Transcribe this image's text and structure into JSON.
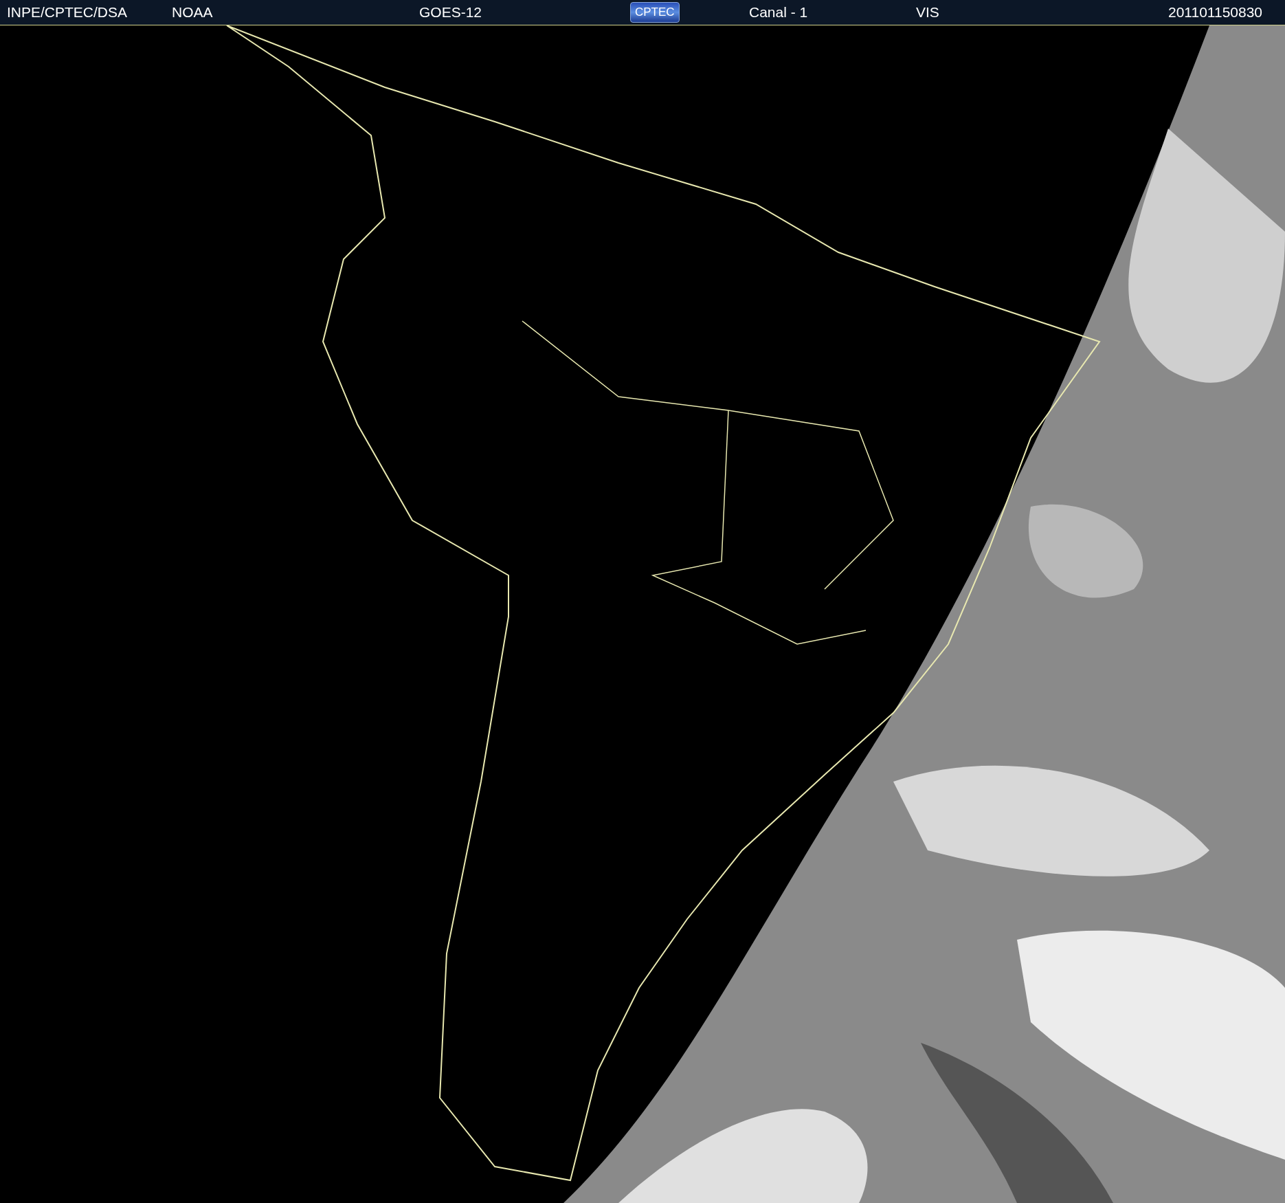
{
  "header": {
    "items": [
      {
        "kind": "text",
        "text": "INPE/CPTEC/DSA"
      },
      {
        "kind": "text",
        "text": "NOAA"
      },
      {
        "kind": "text",
        "text": "GOES-12"
      },
      {
        "kind": "logo",
        "text": "CPTEC"
      },
      {
        "kind": "text",
        "text": "Canal - 1"
      },
      {
        "kind": "text",
        "text": "VIS"
      },
      {
        "kind": "text",
        "text": "201101150830"
      }
    ]
  }
}
